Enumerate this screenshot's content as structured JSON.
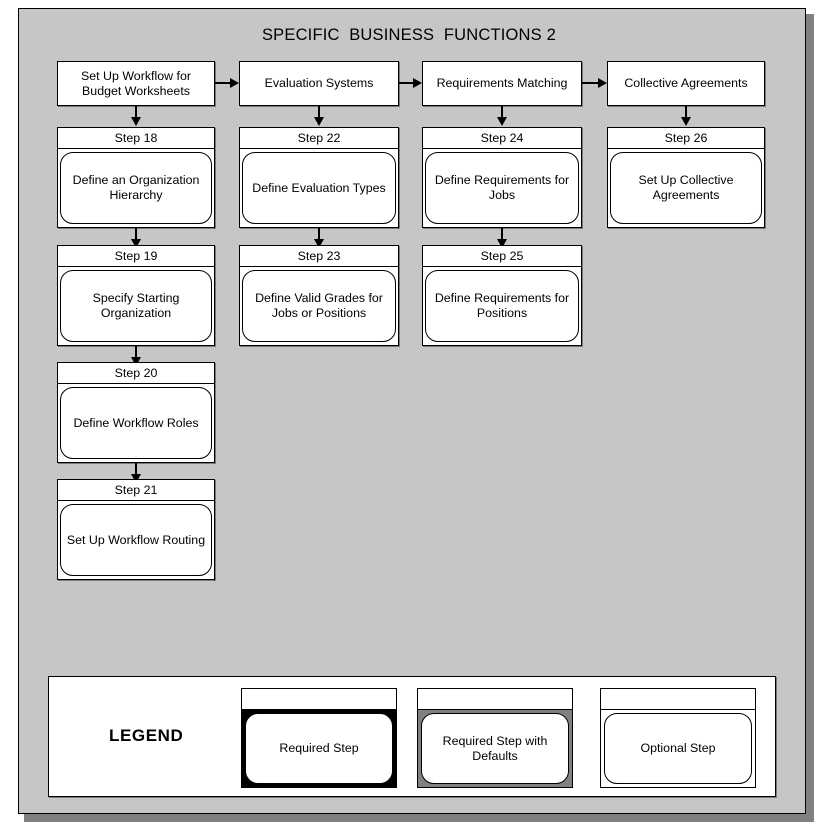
{
  "diagram": {
    "title": "SPECIFIC  BUSINESS  FUNCTIONS 2",
    "background_color": "#c6c6c6",
    "border_color": "#000000",
    "box_fill": "#ffffff"
  },
  "columns": [
    {
      "header": "Set Up Workflow for Budget Worksheets",
      "steps": [
        {
          "number": "Step 18",
          "label": "Define an Organization Hierarchy",
          "type": "optional"
        },
        {
          "number": "Step 19",
          "label": "Specify Starting Organization",
          "type": "optional"
        },
        {
          "number": "Step 20",
          "label": "Define Workflow Roles",
          "type": "optional"
        },
        {
          "number": "Step 21",
          "label": "Set Up Workflow Routing",
          "type": "optional"
        }
      ]
    },
    {
      "header": "Evaluation Systems",
      "steps": [
        {
          "number": "Step 22",
          "label": "Define Evaluation Types",
          "type": "optional"
        },
        {
          "number": "Step 23",
          "label": "Define Valid Grades for Jobs or Positions",
          "type": "optional"
        }
      ]
    },
    {
      "header": "Requirements Matching",
      "steps": [
        {
          "number": "Step 24",
          "label": "Define Requirements for Jobs",
          "type": "optional"
        },
        {
          "number": "Step 25",
          "label": "Define Requirements for Positions",
          "type": "optional"
        }
      ]
    },
    {
      "header": "Collective Agreements",
      "steps": [
        {
          "number": "Step 26",
          "label": "Set Up Collective Agreements",
          "type": "optional"
        }
      ]
    }
  ],
  "legend": {
    "title": "LEGEND",
    "items": [
      {
        "label": "Required Step",
        "fill": "#000000",
        "style": "black"
      },
      {
        "label": "Required Step with Defaults",
        "fill": "#808080",
        "style": "gray"
      },
      {
        "label": "Optional Step",
        "fill": "#ffffff",
        "style": "white"
      }
    ]
  }
}
